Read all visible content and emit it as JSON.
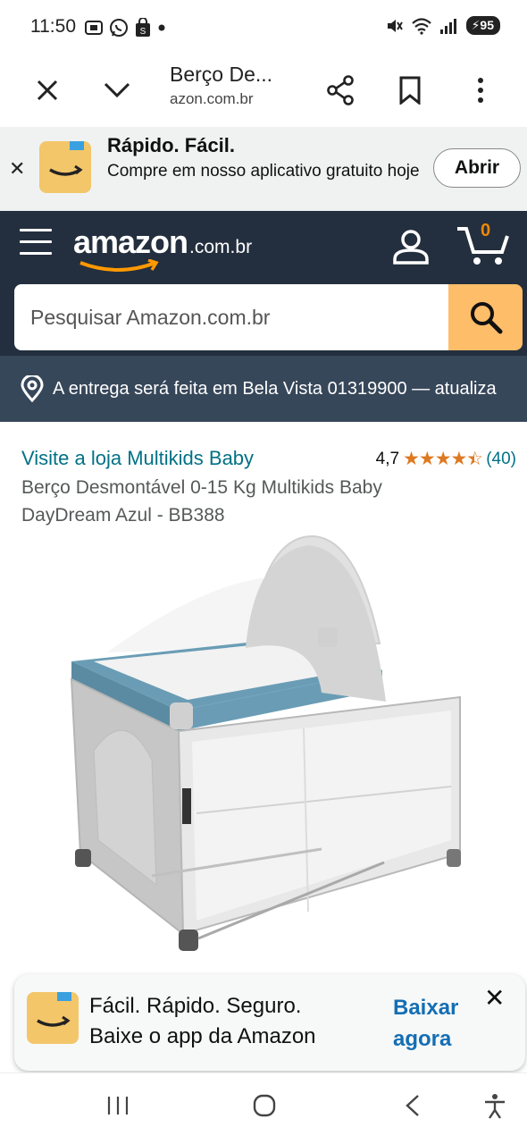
{
  "status_bar": {
    "time": "11:50",
    "battery": "95",
    "left_icons": [
      "screenshot-icon",
      "whatsapp-icon",
      "shopping-icon",
      "dot"
    ],
    "right_icons": [
      "mute-icon",
      "wifi-icon",
      "signal-icon",
      "battery-icon"
    ]
  },
  "browser": {
    "tab_title": "Berço De...",
    "url": "azon.com.br",
    "buttons": [
      "close",
      "dropdown",
      "share",
      "bookmark",
      "more"
    ]
  },
  "app_banner": {
    "title": "Rápido. Fácil.",
    "description": "Compre em nosso aplicativo gratuito hoje",
    "open_label": "Abrir"
  },
  "header": {
    "logo_text": "amazon",
    "logo_tld": ".com.br",
    "cart_count": "0"
  },
  "search": {
    "placeholder": "Pesquisar Amazon.com.br"
  },
  "delivery": {
    "text": "A entrega será feita em Bela Vista 01319900 — atualiza"
  },
  "product": {
    "store_link": "Visite a loja Multikids Baby",
    "rating_value": "4,7",
    "stars_filled": 4.5,
    "rating_count": "(40)",
    "title": "Berço Desmontável 0-15 Kg Multikids Baby DayDream Azul - BB388"
  },
  "promo": {
    "line1": "Fácil. Rápido. Seguro.",
    "line2": "Baixe o app da Amazon",
    "download_label": "Baixar agora"
  },
  "colors": {
    "header_bg": "#232f3e",
    "delivery_bg": "#37475a",
    "search_button": "#febd69",
    "link": "#007185",
    "star": "#de7921",
    "cart_count": "#f08804"
  }
}
